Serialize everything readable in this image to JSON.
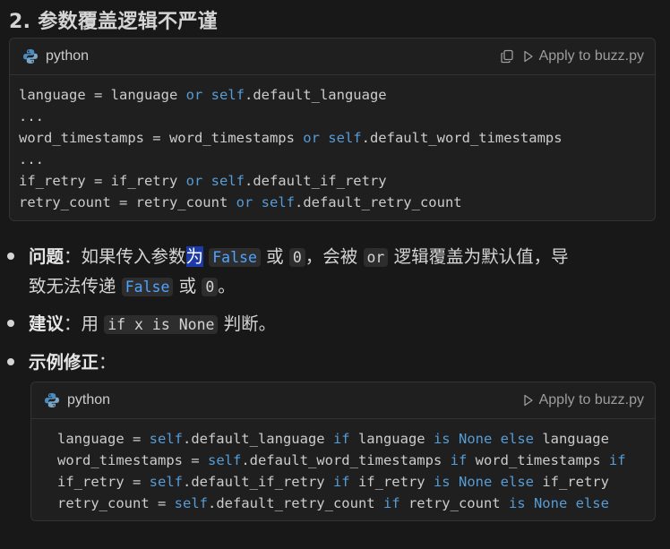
{
  "heading": "2. 参数覆盖逻辑不严谨",
  "code_block_1": {
    "language": "python",
    "apply_label": "Apply to buzz.py",
    "lines": [
      [
        [
          "language = language ",
          ""
        ],
        [
          "or",
          "kw"
        ],
        [
          " ",
          ""
        ],
        [
          "self",
          "kw"
        ],
        [
          ".default_language",
          ""
        ]
      ],
      [
        [
          "...",
          ""
        ]
      ],
      [
        [
          "word_timestamps = word_timestamps ",
          ""
        ],
        [
          "or",
          "kw"
        ],
        [
          " ",
          ""
        ],
        [
          "self",
          "kw"
        ],
        [
          ".default_word_timestamps",
          ""
        ]
      ],
      [
        [
          "...",
          ""
        ]
      ],
      [
        [
          "if_retry = if_retry ",
          ""
        ],
        [
          "or",
          "kw"
        ],
        [
          " ",
          ""
        ],
        [
          "self",
          "kw"
        ],
        [
          ".default_if_retry",
          ""
        ]
      ],
      [
        [
          "retry_count = retry_count ",
          ""
        ],
        [
          "or",
          "kw"
        ],
        [
          " ",
          ""
        ],
        [
          "self",
          "kw"
        ],
        [
          ".default_retry_count",
          ""
        ]
      ]
    ]
  },
  "bullets": {
    "problem_label": "问题",
    "problem_t1": "：如果传入参数",
    "problem_sel": "为",
    "problem_code1": "False",
    "problem_t2": "或",
    "problem_code2": "0",
    "problem_t3": "，会被",
    "problem_code3": "or",
    "problem_t4": "逻辑覆盖为默认值，导",
    "problem_t5": "致无法传递",
    "problem_code4": "False",
    "problem_t6": "或",
    "problem_code5": "0",
    "problem_t7": "。",
    "suggest_label": "建议",
    "suggest_t1": "：用",
    "suggest_code": "if x is None",
    "suggest_t2": "判断。",
    "example_label": "示例修正",
    "example_t1": "："
  },
  "code_block_2": {
    "language": "python",
    "apply_label": "Apply to buzz.py",
    "lines": [
      [
        [
          "language = ",
          ""
        ],
        [
          "self",
          "kw"
        ],
        [
          ".default_language ",
          ""
        ],
        [
          "if",
          "kw"
        ],
        [
          " language ",
          ""
        ],
        [
          "is",
          "kw"
        ],
        [
          " ",
          ""
        ],
        [
          "None",
          "kw"
        ],
        [
          " ",
          ""
        ],
        [
          "else",
          "kw"
        ],
        [
          " language",
          ""
        ]
      ],
      [
        [
          "word_timestamps = ",
          ""
        ],
        [
          "self",
          "kw"
        ],
        [
          ".default_word_timestamps ",
          ""
        ],
        [
          "if",
          "kw"
        ],
        [
          " word_timestamps ",
          ""
        ],
        [
          "if",
          "kw"
        ]
      ],
      [
        [
          "if_retry = ",
          ""
        ],
        [
          "self",
          "kw"
        ],
        [
          ".default_if_retry ",
          ""
        ],
        [
          "if",
          "kw"
        ],
        [
          " if_retry ",
          ""
        ],
        [
          "is",
          "kw"
        ],
        [
          " ",
          ""
        ],
        [
          "None",
          "kw"
        ],
        [
          " ",
          ""
        ],
        [
          "else",
          "kw"
        ],
        [
          " if_retry",
          ""
        ]
      ],
      [
        [
          "retry_count = ",
          ""
        ],
        [
          "self",
          "kw"
        ],
        [
          ".default_retry_count ",
          ""
        ],
        [
          "if",
          "kw"
        ],
        [
          " retry_count ",
          ""
        ],
        [
          "is",
          "kw"
        ],
        [
          " ",
          ""
        ],
        [
          "None",
          "kw"
        ],
        [
          " ",
          ""
        ],
        [
          "else",
          "kw"
        ]
      ]
    ]
  },
  "colors": {
    "keyword": "#569cd6",
    "inline_code_blue": "#4fa3ff",
    "selection": "#1c3aa9"
  },
  "icons": {
    "language": "python-icon",
    "copy": "copy-icon",
    "apply": "play-icon"
  }
}
